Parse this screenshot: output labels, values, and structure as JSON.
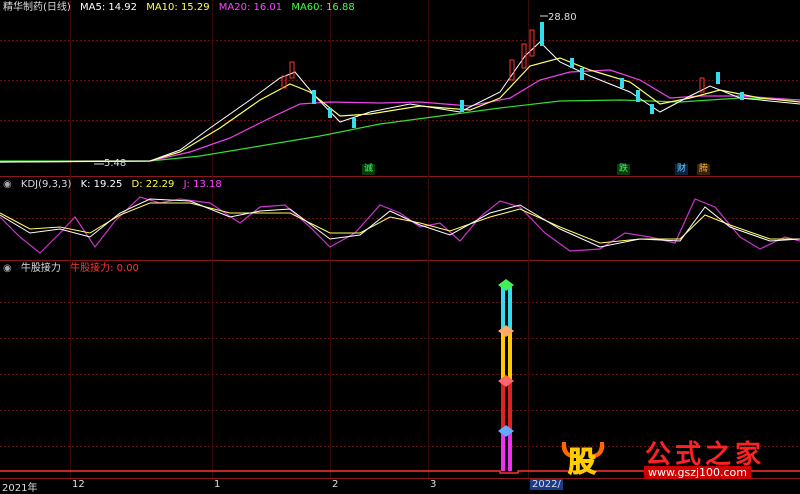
{
  "main_panel": {
    "title": "精华制药(日线)",
    "ma": [
      {
        "label": "MA5: 14.92",
        "color": "#ffffff"
      },
      {
        "label": "MA10: 15.29",
        "color": "#ffff55"
      },
      {
        "label": "MA20: 16.01",
        "color": "#ff44ff"
      },
      {
        "label": "MA60: 16.88",
        "color": "#44ff44"
      }
    ],
    "high_label": "28.80",
    "low_label": "5.48",
    "markers": [
      {
        "text": "诚",
        "color": "#33ff66",
        "bg": "#0a3a0a"
      },
      {
        "text": "跌",
        "color": "#33ff66",
        "bg": "#0a3a0a"
      },
      {
        "text": "财",
        "color": "#66ccff",
        "bg": "#0a2440"
      },
      {
        "text": "腾",
        "color": "#ffaa33",
        "bg": "#3a2408"
      }
    ]
  },
  "kdj_panel": {
    "title": "KDJ(9,3,3)",
    "k": "K: 19.25",
    "d": "D: 22.29",
    "j": "J: 13.18"
  },
  "niu_panel": {
    "title": "牛股接力",
    "value_label": "牛股接力: 0.00"
  },
  "x_axis": {
    "labels": [
      "2021年",
      "12",
      "1",
      "2",
      "3",
      "2022/"
    ]
  },
  "watermark": {
    "logo_char": "股",
    "brand": "公式之家",
    "url": "www.gszj100.com"
  }
}
